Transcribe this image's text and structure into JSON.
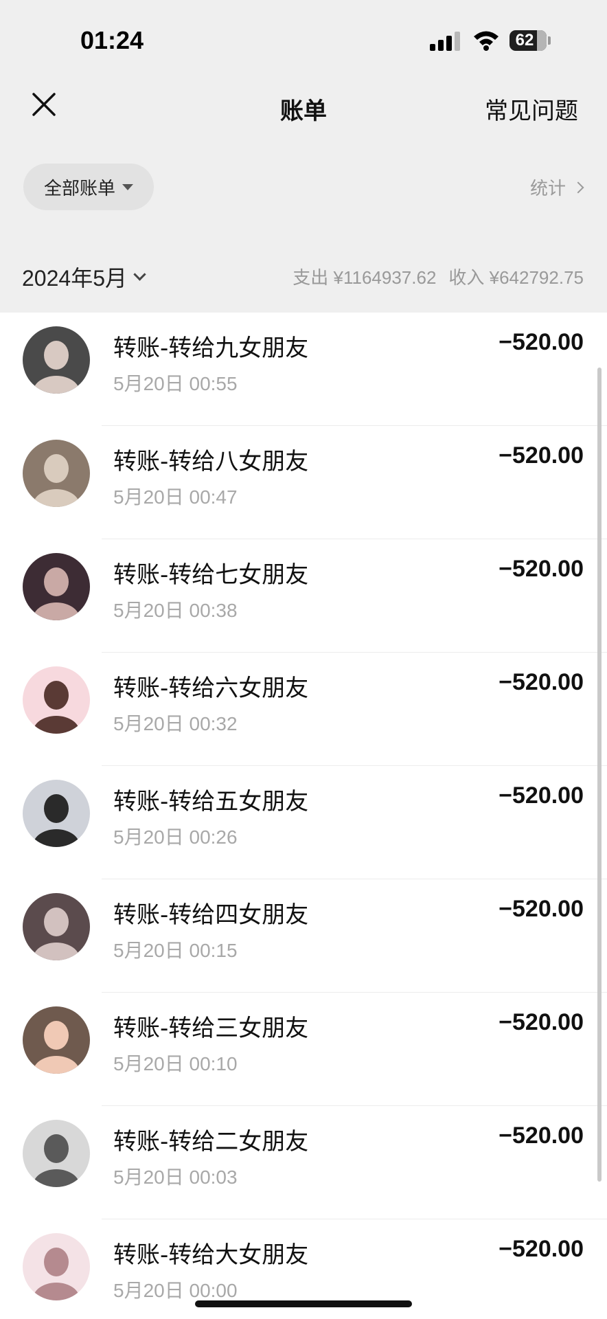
{
  "status_bar": {
    "time": "01:24",
    "battery": "62"
  },
  "nav": {
    "close_icon": "close-icon",
    "title": "账单",
    "faq": "常见问题"
  },
  "filter": {
    "label": "全部账单",
    "stats": "统计"
  },
  "month": {
    "label": "2024年5月",
    "expense": "支出 ¥1164937.62",
    "income": "收入 ¥642792.75"
  },
  "transactions": [
    {
      "title": "转账-转给九女朋友",
      "time": "5月20日 00:55",
      "amount": "−520.00",
      "avatar_bg": "#4a4a4a",
      "avatar_fg": "#d8c9c2"
    },
    {
      "title": "转账-转给八女朋友",
      "time": "5月20日 00:47",
      "amount": "−520.00",
      "avatar_bg": "#8b7a6c",
      "avatar_fg": "#d9cbbd"
    },
    {
      "title": "转账-转给七女朋友",
      "time": "5月20日 00:38",
      "amount": "−520.00",
      "avatar_bg": "#3d2c34",
      "avatar_fg": "#c9a9a5"
    },
    {
      "title": "转账-转给六女朋友",
      "time": "5月20日 00:32",
      "amount": "−520.00",
      "avatar_bg": "#f7d9de",
      "avatar_fg": "#5a3a35"
    },
    {
      "title": "转账-转给五女朋友",
      "time": "5月20日 00:26",
      "amount": "−520.00",
      "avatar_bg": "#cfd2d9",
      "avatar_fg": "#2a2a2a"
    },
    {
      "title": "转账-转给四女朋友",
      "time": "5月20日 00:15",
      "amount": "−520.00",
      "avatar_bg": "#5b4b4d",
      "avatar_fg": "#d2c1bf"
    },
    {
      "title": "转账-转给三女朋友",
      "time": "5月20日 00:10",
      "amount": "−520.00",
      "avatar_bg": "#6f5a4e",
      "avatar_fg": "#f0c9b5"
    },
    {
      "title": "转账-转给二女朋友",
      "time": "5月20日 00:03",
      "amount": "−520.00",
      "avatar_bg": "#d8d8d8",
      "avatar_fg": "#5a5a5a"
    },
    {
      "title": "转账-转给大女朋友",
      "time": "5月20日 00:00",
      "amount": "−520.00",
      "avatar_bg": "#f4e2e6",
      "avatar_fg": "#b58a8f"
    }
  ]
}
